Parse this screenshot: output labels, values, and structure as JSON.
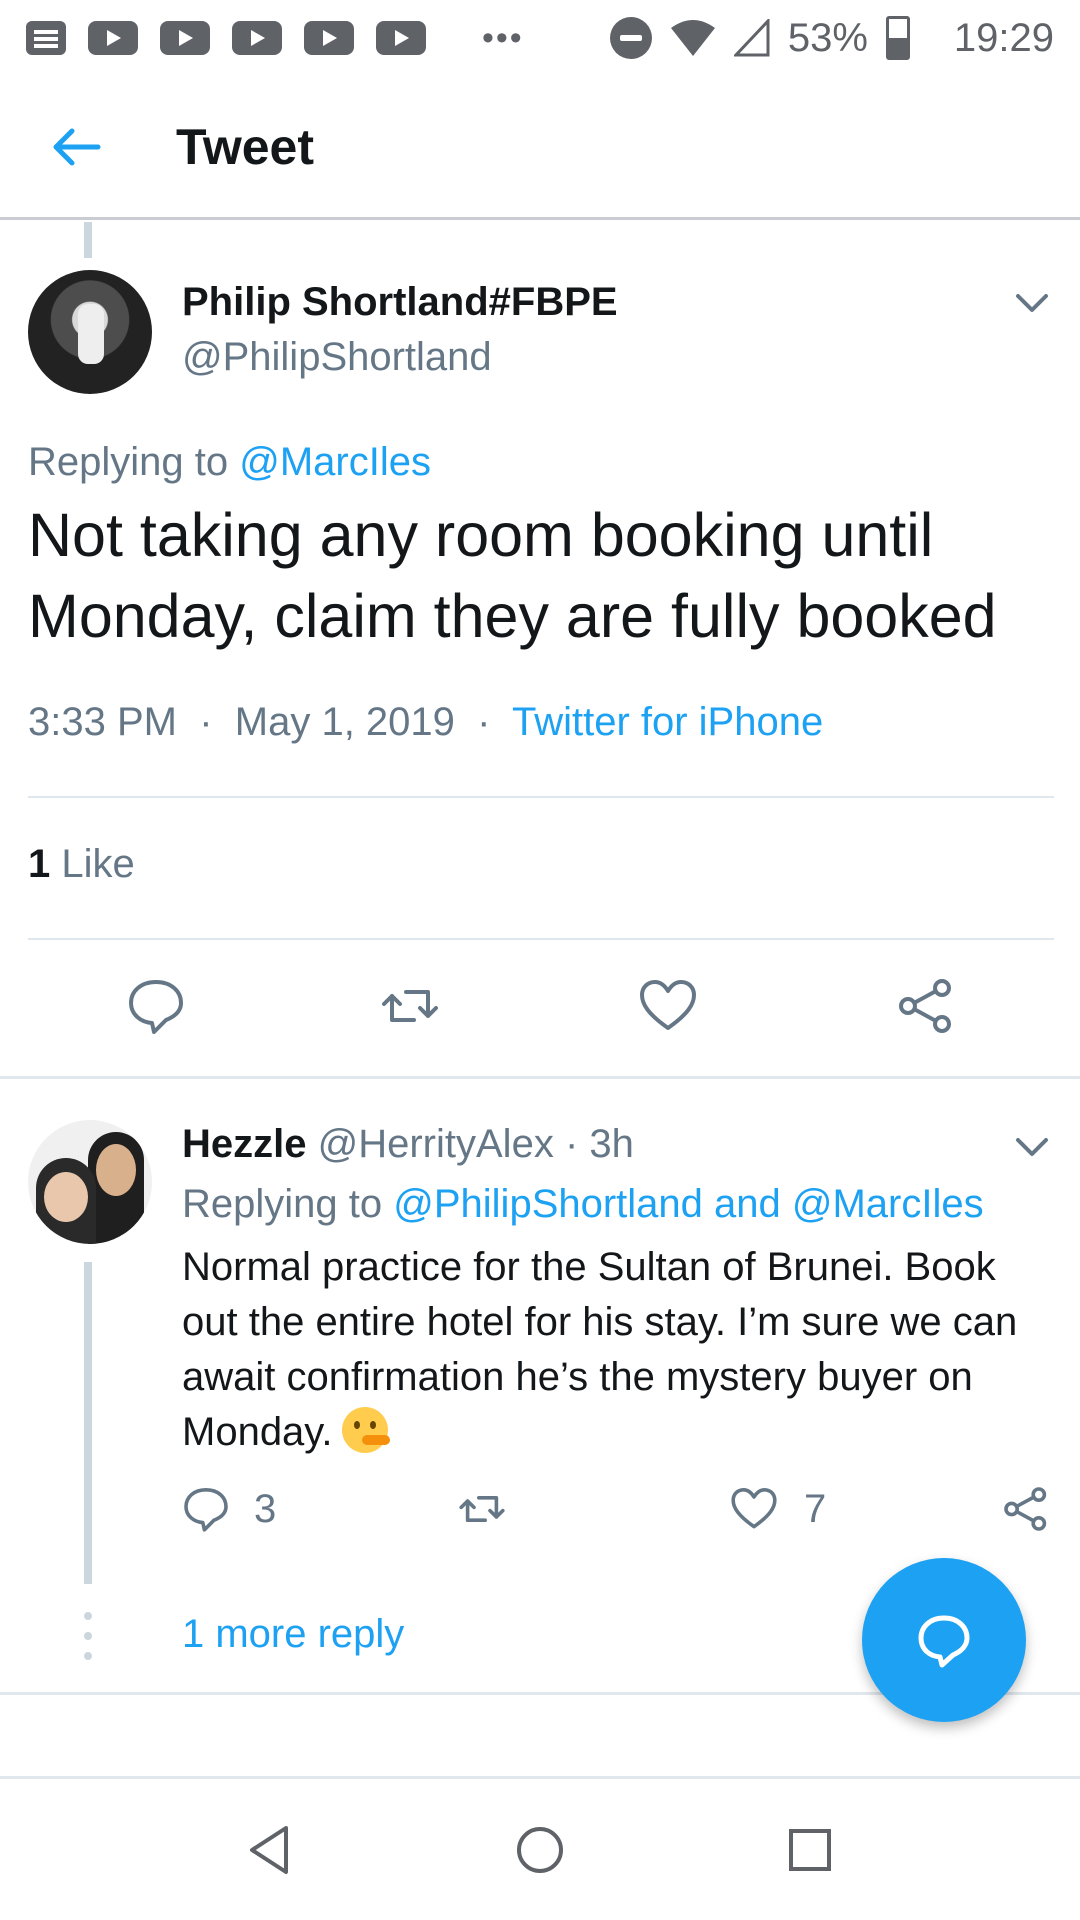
{
  "status_bar": {
    "battery_percent": "53%",
    "time": "19:29",
    "overflow_dots": "•••"
  },
  "header": {
    "title": "Tweet"
  },
  "main_tweet": {
    "author_name": "Philip Shortland#FBPE",
    "author_handle": "@PhilipShortland",
    "replying_prefix": "Replying to",
    "replying_to": "@MarcIles",
    "text": "Not taking any room booking until Monday, claim they are fully booked",
    "time": "3:33 PM",
    "date": "May 1, 2019",
    "source": "Twitter for iPhone",
    "likes_count": "1",
    "likes_label": "Like"
  },
  "reply": {
    "author_name": "Hezzle",
    "author_handle": "@HerrityAlex",
    "age": "3h",
    "replying_prefix": "Replying to",
    "replying_to": "@PhilipShortland and @MarcIles",
    "text": "Normal practice for the Sultan of Brunei. Book out the entire hotel for his stay. I’m sure we can await confirmation he’s the mystery buyer on Monday.",
    "reply_count": "3",
    "like_count": "7",
    "more_replies": "1 more reply"
  },
  "colors": {
    "accent": "#1da1f2",
    "text_primary": "#14171a",
    "text_secondary": "#657786",
    "divider": "#e1e8ed"
  },
  "icons": {
    "back": "arrow-left-icon",
    "reply": "speech-bubble-icon",
    "retweet": "retweet-icon",
    "like": "heart-icon",
    "share": "share-icon",
    "compose": "compose-reply-icon"
  }
}
